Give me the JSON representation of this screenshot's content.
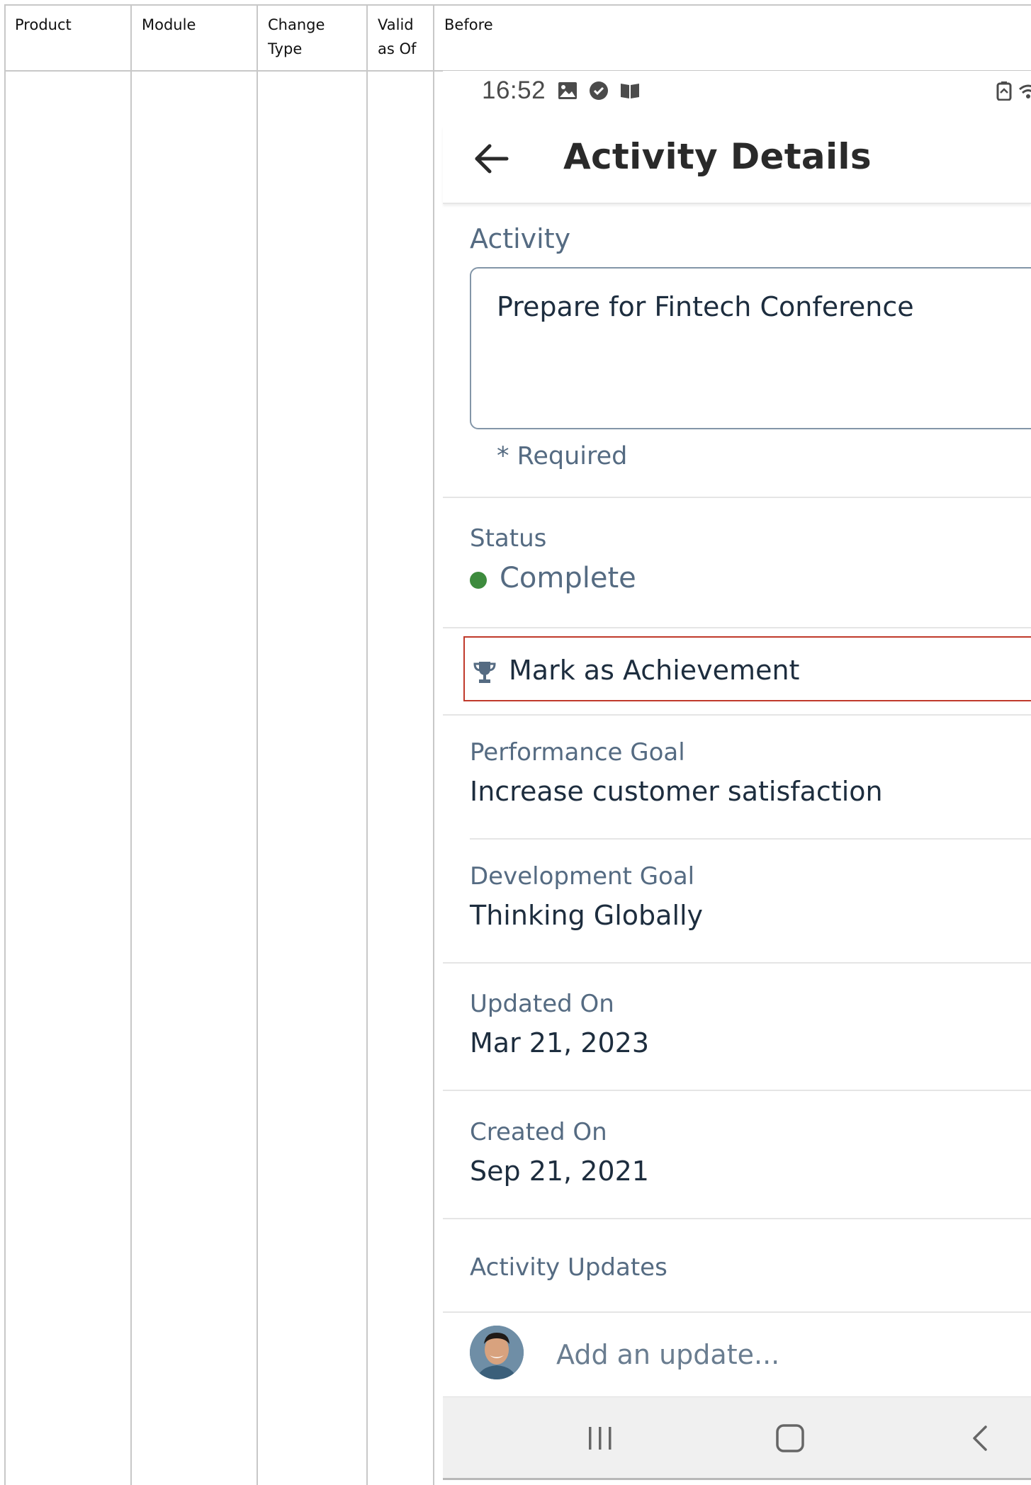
{
  "table": {
    "headers": [
      {
        "line1": "Product",
        "line2": ""
      },
      {
        "line1": "Module",
        "line2": ""
      },
      {
        "line1": "Change",
        "line2": "Type"
      },
      {
        "line1": "Valid",
        "line2": "as Of"
      },
      {
        "line1": "Before",
        "line2": ""
      }
    ]
  },
  "phone": {
    "status_bar": {
      "time": "16:52",
      "icons": [
        "image-icon",
        "check-circle-icon",
        "book-icon",
        "battery-icon",
        "wifi-icon"
      ]
    },
    "app_bar": {
      "title": "Activity Details",
      "back_icon": "arrow-left-icon"
    },
    "activity": {
      "label": "Activity",
      "value": "Prepare for Fintech Conference",
      "required_note": "* Required"
    },
    "status": {
      "label": "Status",
      "value": "Complete",
      "color": "#3d8b3d"
    },
    "achievement": {
      "label": "Mark as Achievement",
      "icon": "trophy-icon",
      "border_color": "#c0392b"
    },
    "performance_goal": {
      "label": "Performance Goal",
      "value": "Increase customer satisfaction"
    },
    "development_goal": {
      "label": "Development Goal",
      "value": "Thinking Globally"
    },
    "updated_on": {
      "label": "Updated On",
      "value": "Mar 21, 2023"
    },
    "created_on": {
      "label": "Created On",
      "value": "Sep 21, 2021"
    },
    "activity_updates": {
      "label": "Activity Updates",
      "placeholder": "Add an update..."
    },
    "nav_bar": {
      "buttons": [
        "recent-apps-icon",
        "home-icon",
        "back-chevron-icon"
      ]
    }
  }
}
